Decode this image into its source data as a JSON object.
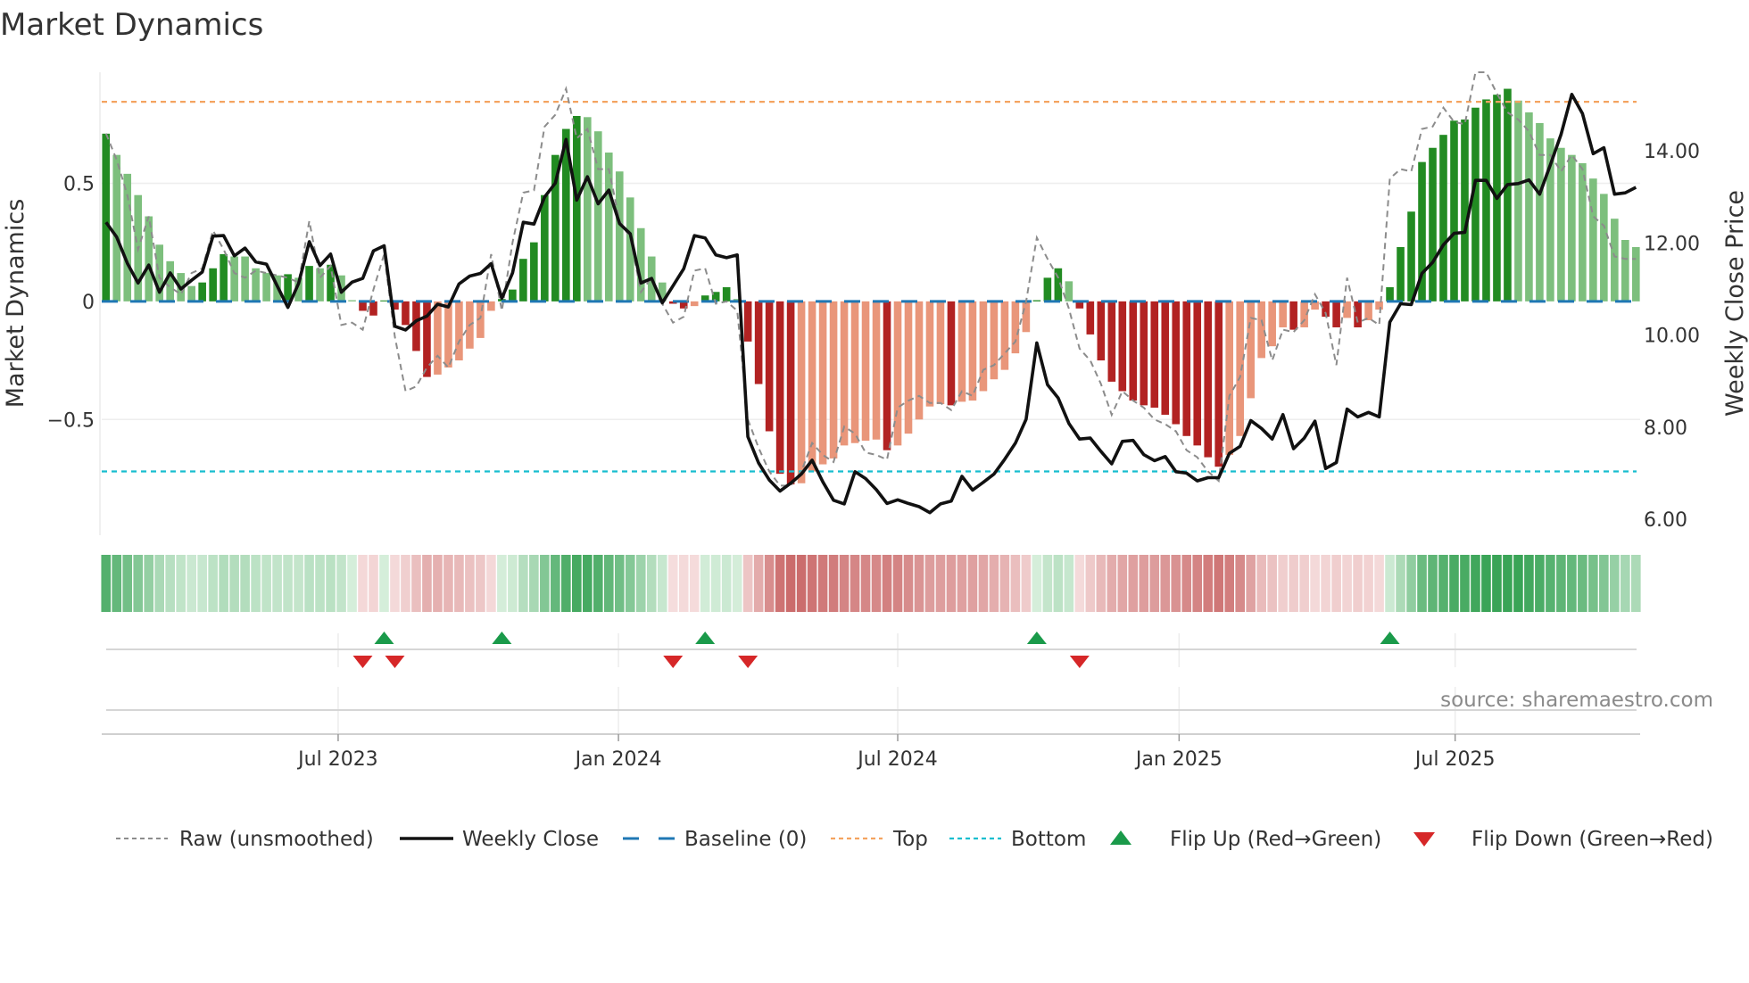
{
  "chart_data": {
    "type": "bar",
    "title": "Market Dynamics",
    "ylabel": "Market Dynamics",
    "ylabel_right": "Weekly Close Price",
    "x_unit": "week index",
    "ylim": [
      -0.99,
      0.97
    ],
    "ylim_right": [
      5.65,
      15.71
    ],
    "yticks": [
      {
        "value": 0.5,
        "label": "0.5"
      },
      {
        "value": 0,
        "label": "0"
      },
      {
        "value": -0.5,
        "label": "−0.5"
      }
    ],
    "yticks_right": [
      {
        "value": 6,
        "label": "6.00"
      },
      {
        "value": 8,
        "label": "8.00"
      },
      {
        "value": 10,
        "label": "10.00"
      },
      {
        "value": 12,
        "label": "12.00"
      },
      {
        "value": 14,
        "label": "14.00"
      }
    ],
    "xticks": [
      {
        "value": 21.7,
        "label": "Jul 2023"
      },
      {
        "value": 47.9,
        "label": "Jan 2024"
      },
      {
        "value": 74.0,
        "label": "Jul 2024"
      },
      {
        "value": 100.3,
        "label": "Jan 2025"
      },
      {
        "value": 126.1,
        "label": "Jul 2025"
      }
    ],
    "grid": "horizontal",
    "baseline": 0,
    "top": 0.845,
    "bottom": -0.72,
    "dynamics": [
      0.71,
      0.62,
      0.54,
      0.45,
      0.36,
      0.24,
      0.17,
      0.12,
      0.065,
      0.08,
      0.14,
      0.2,
      0.19,
      0.19,
      0.14,
      0.12,
      0.11,
      0.115,
      0.1,
      0.15,
      0.14,
      0.155,
      0.11,
      0.005,
      -0.04,
      -0.06,
      0.004,
      -0.035,
      -0.1,
      -0.21,
      -0.32,
      -0.31,
      -0.28,
      -0.25,
      -0.2,
      -0.155,
      -0.04,
      0.01,
      0.05,
      0.18,
      0.25,
      0.45,
      0.62,
      0.73,
      0.785,
      0.78,
      0.72,
      0.63,
      0.55,
      0.44,
      0.31,
      0.19,
      0.08,
      -0.01,
      -0.03,
      -0.02,
      0.025,
      0.04,
      0.06,
      0.01,
      -0.17,
      -0.35,
      -0.55,
      -0.73,
      -0.775,
      -0.77,
      -0.72,
      -0.69,
      -0.665,
      -0.61,
      -0.6,
      -0.59,
      -0.585,
      -0.63,
      -0.61,
      -0.56,
      -0.5,
      -0.445,
      -0.435,
      -0.44,
      -0.425,
      -0.42,
      -0.38,
      -0.33,
      -0.29,
      -0.22,
      -0.13,
      0.005,
      0.1,
      0.14,
      0.085,
      -0.03,
      -0.14,
      -0.25,
      -0.34,
      -0.38,
      -0.42,
      -0.44,
      -0.45,
      -0.48,
      -0.52,
      -0.57,
      -0.61,
      -0.66,
      -0.7,
      -0.65,
      -0.57,
      -0.41,
      -0.24,
      -0.19,
      -0.11,
      -0.12,
      -0.11,
      -0.035,
      -0.065,
      -0.11,
      -0.07,
      -0.11,
      -0.08,
      -0.035,
      0.06,
      0.23,
      0.38,
      0.59,
      0.65,
      0.705,
      0.765,
      0.77,
      0.82,
      0.855,
      0.875,
      0.9,
      0.85,
      0.8,
      0.755,
      0.69,
      0.65,
      0.62,
      0.585,
      0.52,
      0.455,
      0.35,
      0.26,
      0.23
    ],
    "raw": [
      0.71,
      0.6,
      0.45,
      0.22,
      0.36,
      0.1,
      0.06,
      0.03,
      0.12,
      0.14,
      0.3,
      0.22,
      0.12,
      0.1,
      0.13,
      0.12,
      0.11,
      0.1,
      0.08,
      0.34,
      0.1,
      0.15,
      -0.1,
      -0.09,
      -0.12,
      0.05,
      0.2,
      -0.15,
      -0.38,
      -0.36,
      -0.28,
      -0.23,
      -0.28,
      -0.17,
      -0.1,
      -0.07,
      0.2,
      -0.04,
      0.25,
      0.46,
      0.47,
      0.74,
      0.79,
      0.9,
      0.69,
      0.73,
      0.56,
      0.56,
      0.34,
      0.27,
      0.04,
      0.1,
      -0.01,
      -0.09,
      -0.065,
      0.13,
      0.14,
      -0.01,
      0.0,
      -0.04,
      -0.5,
      -0.62,
      -0.72,
      -0.78,
      -0.78,
      -0.72,
      -0.6,
      -0.65,
      -0.68,
      -0.53,
      -0.56,
      -0.64,
      -0.65,
      -0.67,
      -0.45,
      -0.42,
      -0.4,
      -0.43,
      -0.43,
      -0.46,
      -0.38,
      -0.4,
      -0.29,
      -0.27,
      -0.22,
      -0.17,
      0.0,
      0.27,
      0.18,
      0.1,
      -0.03,
      -0.2,
      -0.25,
      -0.35,
      -0.48,
      -0.38,
      -0.42,
      -0.45,
      -0.5,
      -0.52,
      -0.55,
      -0.63,
      -0.66,
      -0.72,
      -0.76,
      -0.4,
      -0.32,
      -0.07,
      -0.08,
      -0.25,
      -0.12,
      -0.13,
      -0.08,
      0.03,
      -0.05,
      -0.27,
      0.1,
      -0.09,
      -0.07,
      -0.1,
      0.52,
      0.56,
      0.55,
      0.73,
      0.74,
      0.82,
      0.76,
      0.75,
      0.97,
      0.97,
      0.88,
      0.8,
      0.77,
      0.72,
      0.62,
      0.62,
      0.55,
      0.62,
      0.56,
      0.36,
      0.32,
      0.19,
      0.18,
      0.18
    ],
    "close": [
      12.45,
      12.13,
      11.56,
      11.13,
      11.52,
      10.93,
      11.35,
      11.0,
      11.19,
      11.37,
      12.15,
      12.16,
      11.72,
      11.89,
      11.59,
      11.54,
      11.07,
      10.6,
      11.12,
      12.03,
      11.51,
      11.76,
      10.93,
      11.15,
      11.23,
      11.83,
      11.94,
      10.19,
      10.11,
      10.31,
      10.41,
      10.67,
      10.61,
      11.11,
      11.28,
      11.34,
      11.55,
      10.8,
      11.35,
      12.45,
      12.41,
      13.0,
      13.3,
      14.25,
      12.93,
      13.44,
      12.85,
      13.15,
      12.42,
      12.2,
      11.13,
      11.23,
      10.7,
      11.07,
      11.44,
      12.16,
      12.11,
      11.74,
      11.68,
      11.74,
      7.79,
      7.22,
      6.85,
      6.61,
      6.78,
      6.98,
      7.28,
      6.81,
      6.41,
      6.33,
      7.03,
      6.88,
      6.64,
      6.34,
      6.42,
      6.34,
      6.27,
      6.14,
      6.33,
      6.39,
      6.93,
      6.63,
      6.8,
      6.98,
      7.3,
      7.65,
      8.17,
      9.83,
      8.92,
      8.63,
      8.08,
      7.74,
      7.76,
      7.47,
      7.2,
      7.69,
      7.71,
      7.4,
      7.27,
      7.36,
      7.03,
      7.0,
      6.83,
      6.9,
      6.9,
      7.43,
      7.58,
      8.14,
      7.97,
      7.74,
      8.27,
      7.53,
      7.76,
      8.13,
      7.1,
      7.23,
      8.39,
      8.22,
      8.32,
      8.22,
      10.28,
      10.68,
      10.66,
      11.34,
      11.58,
      11.96,
      12.21,
      12.23,
      13.36,
      13.36,
      12.97,
      13.27,
      13.29,
      13.37,
      13.06,
      13.7,
      14.36,
      15.23,
      14.81,
      13.94,
      14.07,
      13.06,
      13.09,
      13.21
    ],
    "flip_up": [
      26,
      37,
      56,
      87,
      120
    ],
    "flip_down": [
      24,
      27,
      53,
      60,
      91
    ],
    "legend": [
      {
        "key": "raw",
        "label": "Raw (unsmoothed)"
      },
      {
        "key": "close",
        "label": "Weekly Close"
      },
      {
        "key": "baseline",
        "label": "Baseline (0)"
      },
      {
        "key": "top",
        "label": "Top"
      },
      {
        "key": "bottom",
        "label": "Bottom"
      },
      {
        "key": "flip_up",
        "label": "Flip Up (Red→Green)"
      },
      {
        "key": "flip_down",
        "label": "Flip Down (Green→Red)"
      }
    ],
    "legend_position": "bottom",
    "source": "source: sharemaestro.com",
    "colors": {
      "green_strong": "#228b22",
      "green_weak": "#7dbf7d",
      "red_strong": "#b22222",
      "red_weak": "#e9967a",
      "raw": "#8c8c8c",
      "close": "#111111",
      "baseline": "#1f77b4",
      "top": "#f4a460",
      "bottom": "#17becf",
      "flip_up": "#1a9a4a",
      "flip_down": "#d62728"
    }
  }
}
